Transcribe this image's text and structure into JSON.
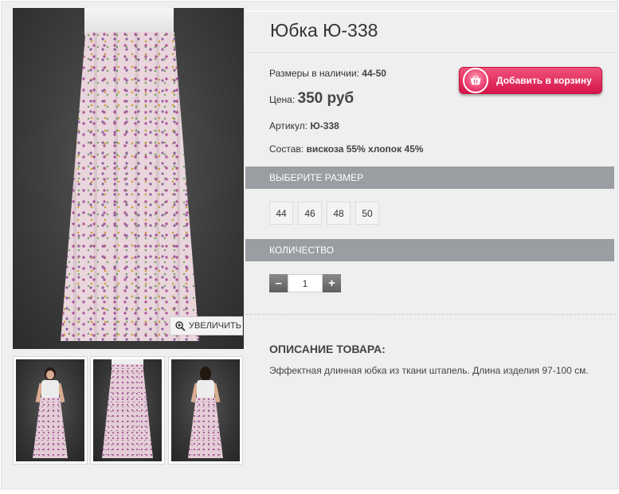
{
  "product": {
    "title": "Юбка Ю-338",
    "sizes_label": "Размеры в наличии:",
    "sizes_value": "44-50",
    "price_label": "Цена:",
    "price_value": "350 руб",
    "sku_label": "Артикул:",
    "sku_value": "Ю-338",
    "composition_label": "Состав:",
    "composition_value": "вискоза 55% хлопок 45%"
  },
  "cart_button": {
    "label": "Добавить в корзину",
    "icon": "basket-icon"
  },
  "gallery": {
    "zoom_label": "УВЕЛИЧИТЬ",
    "zoom_icon": "magnifier-plus-icon",
    "thumbnails": [
      "front-view",
      "skirt-view",
      "back-view"
    ]
  },
  "size_section": {
    "title": "ВЫБЕРИТЕ РАЗМЕР",
    "options": [
      "44",
      "46",
      "48",
      "50"
    ]
  },
  "quantity_section": {
    "title": "КОЛИЧЕСТВО",
    "minus": "–",
    "plus": "+",
    "value": "1"
  },
  "description": {
    "title": "ОПИСАНИЕ ТОВАРА:",
    "text": "Эффектная длинная юбка из ткани штапель. Длина изделия 97-100 см."
  },
  "colors": {
    "cart_button": "#e22a5c",
    "section_bar": "#9a9da2",
    "background": "#efefef"
  }
}
